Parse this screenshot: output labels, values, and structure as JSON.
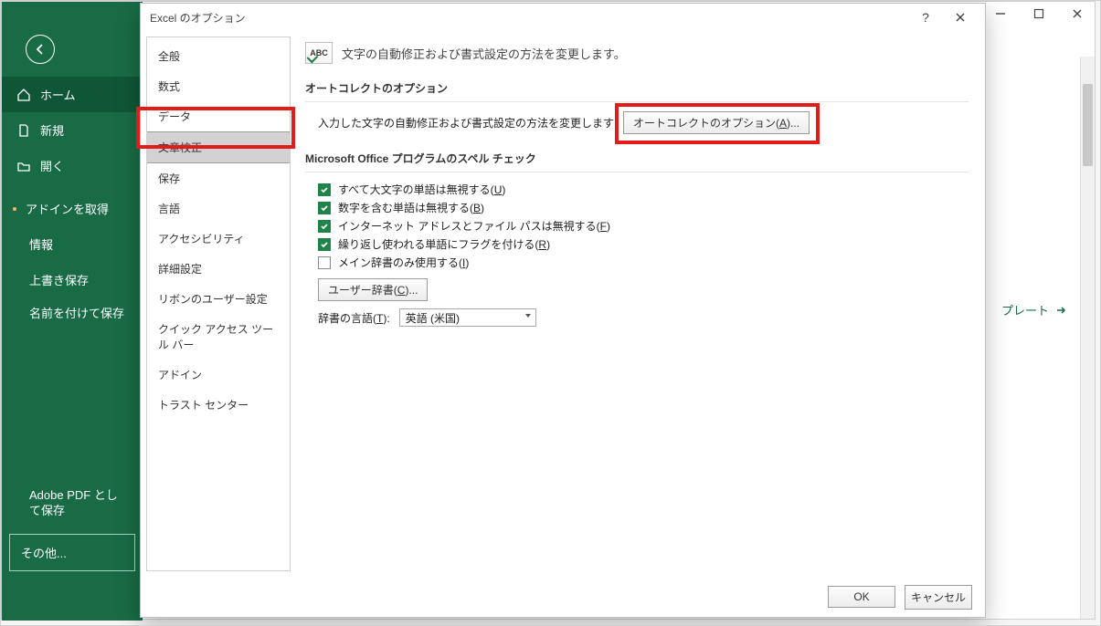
{
  "backstage": {
    "home": "ホーム",
    "new": "新規",
    "open": "開く",
    "addins": "アドインを取得",
    "info": "情報",
    "save": "上書き保存",
    "saveas": "名前を付けて保存",
    "adobepdf": "Adobe PDF として保存",
    "other": "その他..."
  },
  "dialog": {
    "title": "Excel のオプション",
    "nav": {
      "general": "全般",
      "formulas": "数式",
      "data": "データ",
      "proofing": "文章校正",
      "save": "保存",
      "lang": "言語",
      "access": "アクセシビリティ",
      "advanced": "詳細設定",
      "ribbon": "リボンのユーザー設定",
      "qat": "クイック アクセス ツール バー",
      "addins": "アドイン",
      "trust": "トラスト センター"
    },
    "content": {
      "heading": "文字の自動修正および書式設定の方法を変更します。",
      "sec_autocorrect": "オートコレクトのオプション",
      "autocorrect_desc": "入力した文字の自動修正および書式設定の方法を変更します",
      "autocorrect_btn": "オートコレクトのオプション(A)...",
      "sec_spell": "Microsoft Office プログラムのスペル チェック",
      "chk_upper": "すべて大文字の単語は無視する(U)",
      "chk_num": "数字を含む単語は無視する(B)",
      "chk_url": "インターネット アドレスとファイル パスは無視する(F)",
      "chk_repeat": "繰り返し使われる単語にフラグを付ける(R)",
      "chk_maindict": "メイン辞書のみ使用する(I)",
      "userdict_btn": "ユーザー辞書(C)...",
      "dict_lang_label": "辞書の言語(T):",
      "dict_lang_value": "英語 (米国)"
    },
    "footer": {
      "ok": "OK",
      "cancel": "キャンセル"
    }
  },
  "main": {
    "template_hint": "プレート"
  }
}
